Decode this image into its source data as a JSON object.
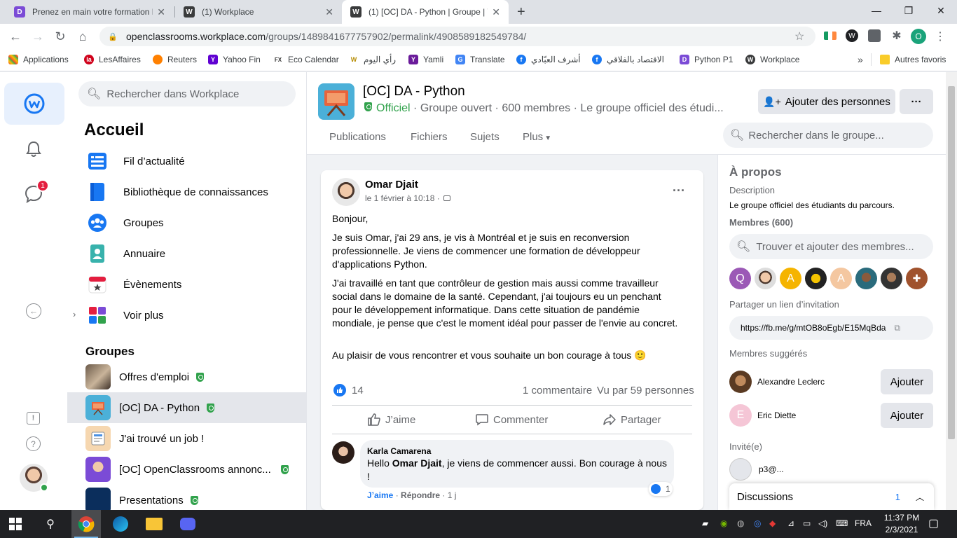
{
  "browser": {
    "tabs": [
      {
        "title": "Prenez en main votre formation Ra"
      },
      {
        "title": "(1) Workplace"
      },
      {
        "title": "(1) [OC] DA - Python | Groupe | W"
      }
    ],
    "url_host": "openclassrooms.workplace.com",
    "url_path": "/groups/1489841677757902/permalink/4908589182549784/",
    "profile_initial": "O",
    "bookmarks": [
      "Applications",
      "LesAffaires",
      "Reuters",
      "Yahoo Fin",
      "Eco Calendar",
      "رأي اليوم",
      "Yamli",
      "Translate",
      "أشرف العبّادي",
      "الاقتصاد بالفلاقي",
      "Python P1",
      "Workplace"
    ],
    "other_bookmarks": "Autres favoris",
    "more_bookmarks": "»"
  },
  "rail": {
    "chat_badge": "1"
  },
  "leftnav": {
    "search_placeholder": "Rechercher dans Workplace",
    "home_title": "Accueil",
    "items": [
      {
        "label": "Fil d’actualité",
        "icon": "news-feed-icon"
      },
      {
        "label": "Bibliothèque de connaissances",
        "icon": "library-icon"
      },
      {
        "label": "Groupes",
        "icon": "groups-icon"
      },
      {
        "label": "Annuaire",
        "icon": "directory-icon"
      },
      {
        "label": "Évènements",
        "icon": "events-icon"
      },
      {
        "label": "Voir plus",
        "icon": "see-more-icon"
      }
    ],
    "groups_title": "Groupes",
    "groups": [
      {
        "label": "Offres d'emploi"
      },
      {
        "label": "[OC] DA - Python"
      },
      {
        "label": "J'ai trouvé un job !"
      },
      {
        "label": "[OC] OpenClassrooms annonc..."
      },
      {
        "label": "Presentations"
      }
    ]
  },
  "group": {
    "title": "[OC] DA - Python",
    "official": "Officiel",
    "subtitle": " · Groupe ouvert · 600 membres · Le groupe officiel des étudi...",
    "add_people": "Ajouter des personnes",
    "more": "···",
    "tabs": [
      "Publications",
      "Fichiers",
      "Sujets",
      "Plus"
    ],
    "search_placeholder": "Rechercher dans le groupe..."
  },
  "post": {
    "author": "Omar Djait",
    "meta": "le 1 février à 10:18 ·",
    "paragraphs": [
      "Bonjour,",
      "Je suis Omar, j'ai 29 ans, je vis à Montréal et je suis en reconversion professionnelle. Je viens de commencer une formation de développeur d'applications Python.",
      "J'ai travaillé en tant que contrôleur de gestion mais aussi comme travailleur social dans le domaine de la santé. Cependant, j'ai toujours eu un penchant pour le développement informatique. Dans cette situation de pandémie mondiale, je pense que c'est le moment idéal pour passer de l'envie au concret.",
      "Au plaisir de vous rencontrer et vous souhaite un bon courage à tous 🙂"
    ],
    "likes": "14",
    "comments_count": "1 commentaire",
    "seen_by": "Vu par 59 personnes",
    "like_label": "J’aime",
    "comment_label": "Commenter",
    "share_label": "Partager",
    "comment": {
      "author": "Karla Camarena",
      "text_prefix": "Hello ",
      "mention": "Omar Djait",
      "text_suffix": ", je viens de commencer aussi. Bon courage à nous !",
      "likes": "1",
      "like": "J’aime",
      "reply": "Répondre",
      "time": "1 j"
    }
  },
  "about": {
    "title": "À propos",
    "description_label": "Description",
    "description": "Le groupe officiel des étudiants du parcours.",
    "members_label": "Membres (600)",
    "find_members_placeholder": "Trouver et ajouter des membres...",
    "member_initials": [
      "Q",
      "",
      "A",
      "",
      "A",
      "",
      "",
      ""
    ],
    "invite_label": "Partager un lien d’invitation",
    "invite_link": "https://fb.me/g/mtOB8oEgb/E15MqBda",
    "suggested_label": "Membres suggérés",
    "suggested": [
      {
        "name": "Alexandre Leclerc",
        "initial": "",
        "button": "Ajouter"
      },
      {
        "name": "Eric Diette",
        "initial": "E",
        "button": "Ajouter"
      }
    ],
    "invited_label": "Invité(e)",
    "invited": "p3@..."
  },
  "discussions": {
    "label": "Discussions",
    "count": "1"
  },
  "taskbar": {
    "lang": "FRA",
    "time": "11:37 PM",
    "date": "2/3/2021"
  }
}
